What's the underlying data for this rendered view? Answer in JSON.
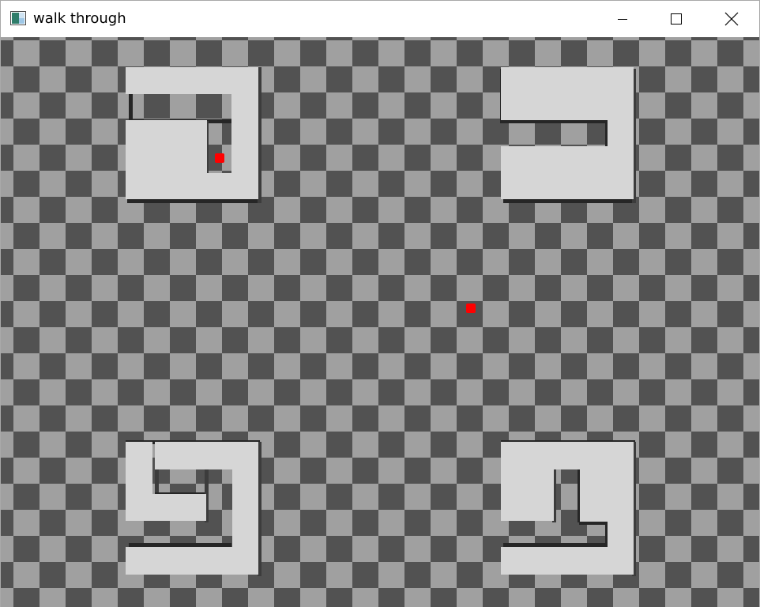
{
  "window": {
    "title": "walk through",
    "icons": {
      "app": "app-window-icon",
      "minimize": "minimize-icon",
      "maximize": "maximize-icon",
      "close": "close-icon"
    }
  },
  "scene": {
    "floor_colors": {
      "dark": "#525252",
      "light": "#a0a0a0"
    },
    "wall_colors": {
      "top": "#d6d6d6",
      "side_dark": "#262626",
      "side_mid": "#3c3c3c"
    },
    "marker_color": "#ff0000",
    "markers": [
      "target-marker",
      "player-marker"
    ]
  }
}
